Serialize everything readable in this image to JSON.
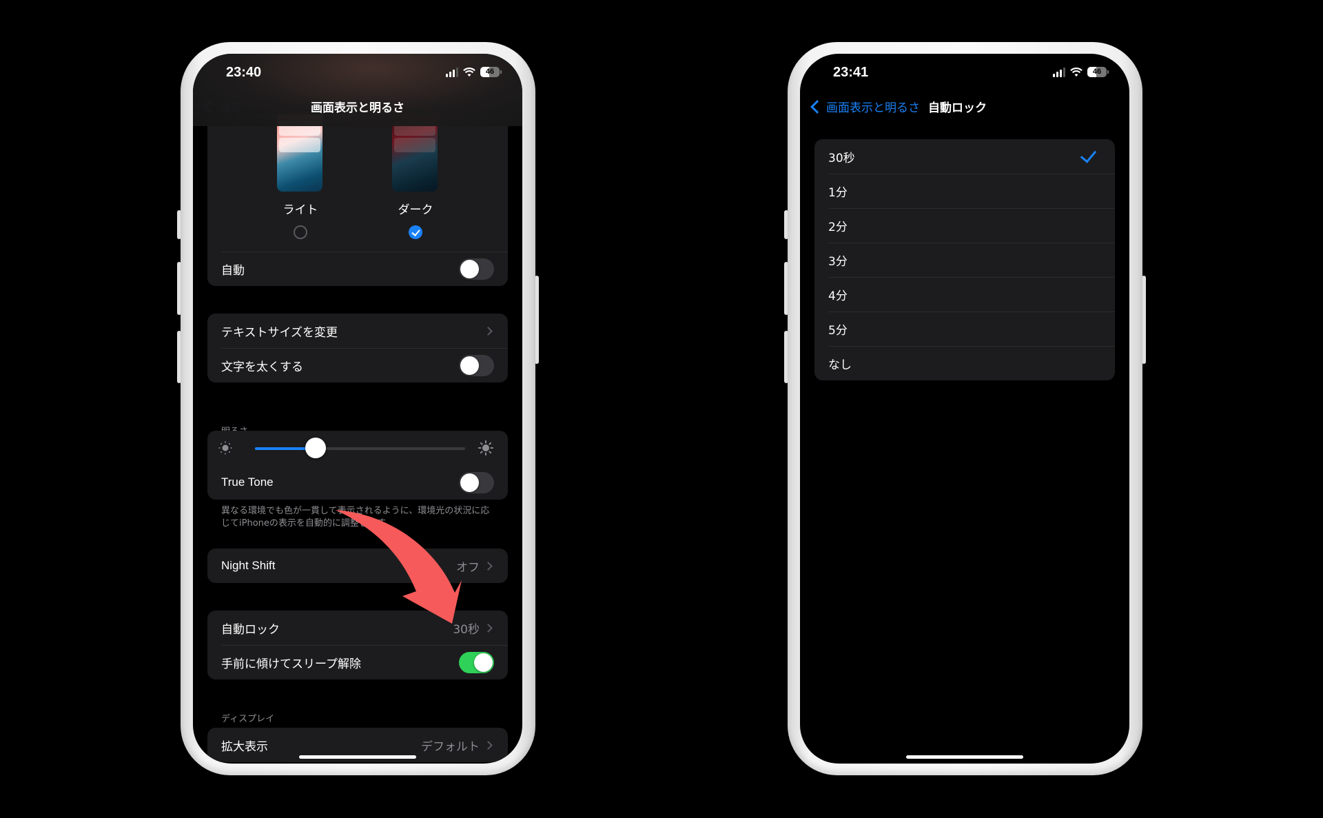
{
  "left_phone": {
    "status": {
      "time": "23:40",
      "battery": "46",
      "battery_level": 0.46,
      "signal_bars": 3
    },
    "nav": {
      "back_label": "設定",
      "title": "画面表示と明るさ"
    },
    "appearance": {
      "options": [
        {
          "label": "ライト",
          "selected": false
        },
        {
          "label": "ダーク",
          "selected": true
        }
      ],
      "auto_label": "自動",
      "auto_on": false
    },
    "text_group": {
      "text_size_label": "テキストサイズを変更",
      "bold_text_label": "文字を太くする",
      "bold_text_on": false
    },
    "brightness": {
      "header": "明るさ",
      "level": 0.29,
      "true_tone_label": "True Tone",
      "true_tone_on": false,
      "footer": "異なる環境でも色が一貫して表示されるように、環境光の状況に応じてiPhoneの表示を自動的に調整します。"
    },
    "night_shift": {
      "label": "Night Shift",
      "value": "オフ"
    },
    "lock_group": {
      "auto_lock_label": "自動ロック",
      "auto_lock_value": "30秒",
      "raise_to_wake_label": "手前に傾けてスリープ解除",
      "raise_to_wake_on": true
    },
    "display": {
      "header": "ディスプレイ",
      "zoom_label": "拡大表示",
      "zoom_value": "デフォルト"
    }
  },
  "right_phone": {
    "status": {
      "time": "23:41",
      "battery": "46",
      "battery_level": 0.46,
      "signal_bars": 3
    },
    "nav": {
      "back_label": "画面表示と明るさ",
      "title": "自動ロック"
    },
    "options": [
      {
        "label": "30秒",
        "selected": true
      },
      {
        "label": "1分",
        "selected": false
      },
      {
        "label": "2分",
        "selected": false
      },
      {
        "label": "3分",
        "selected": false
      },
      {
        "label": "4分",
        "selected": false
      },
      {
        "label": "5分",
        "selected": false
      },
      {
        "label": "なし",
        "selected": false
      }
    ]
  },
  "colors": {
    "accent_blue": "#1a82f7",
    "toggle_on_green": "#30d158",
    "annotation_arrow": "#f65a5a",
    "group_bg": "#1c1c1e"
  }
}
